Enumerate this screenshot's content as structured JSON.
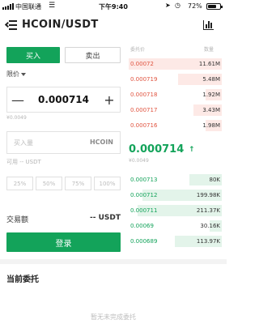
{
  "status_bar": {
    "carrier": "中国联通",
    "time": "下午9:40",
    "battery_percent": "72%",
    "battery_level": 0.72
  },
  "header": {
    "pair": "HCOIN/USDT",
    "menu_icon": "menu-collapse-icon",
    "chart_icon": "bar-chart-icon"
  },
  "form": {
    "buy_label": "买入",
    "sell_label": "卖出",
    "order_type": "限价",
    "price_value": "0.000714",
    "price_ref": "¥0.0049",
    "amount_placeholder": "买入量",
    "amount_unit": "HCOIN",
    "available": "可用 -- USDT",
    "percents": [
      "25%",
      "50%",
      "75%",
      "100%"
    ],
    "trade_amount_label": "交易额",
    "trade_amount_value": "-- USDT",
    "login_label": "登录"
  },
  "order_book": {
    "price_header": "委托价",
    "qty_header": "数量",
    "asks": [
      {
        "price": "0.00072",
        "qty": "11.61M",
        "depth": 1.0
      },
      {
        "price": "0.000719",
        "qty": "5.48M",
        "depth": 0.47
      },
      {
        "price": "0.000718",
        "qty": "1.92M",
        "depth": 0.17
      },
      {
        "price": "0.000717",
        "qty": "3.43M",
        "depth": 0.3
      },
      {
        "price": "0.000716",
        "qty": "1.98M",
        "depth": 0.17
      }
    ],
    "last_price": "0.000714",
    "last_price_ref": "¥0.0049",
    "bids": [
      {
        "price": "0.000713",
        "qty": "80K",
        "depth": 0.35
      },
      {
        "price": "0.000712",
        "qty": "199.98K",
        "depth": 0.85
      },
      {
        "price": "0.000711",
        "qty": "211.37K",
        "depth": 0.9
      },
      {
        "price": "0.00069",
        "qty": "30.16K",
        "depth": 0.13
      },
      {
        "price": "0.000689",
        "qty": "113.97K",
        "depth": 0.5
      }
    ],
    "colors": {
      "ask": "#e0533f",
      "bid": "#13a35a"
    }
  },
  "orders": {
    "title": "当前委托",
    "empty_text": "暂无未完成委托"
  }
}
